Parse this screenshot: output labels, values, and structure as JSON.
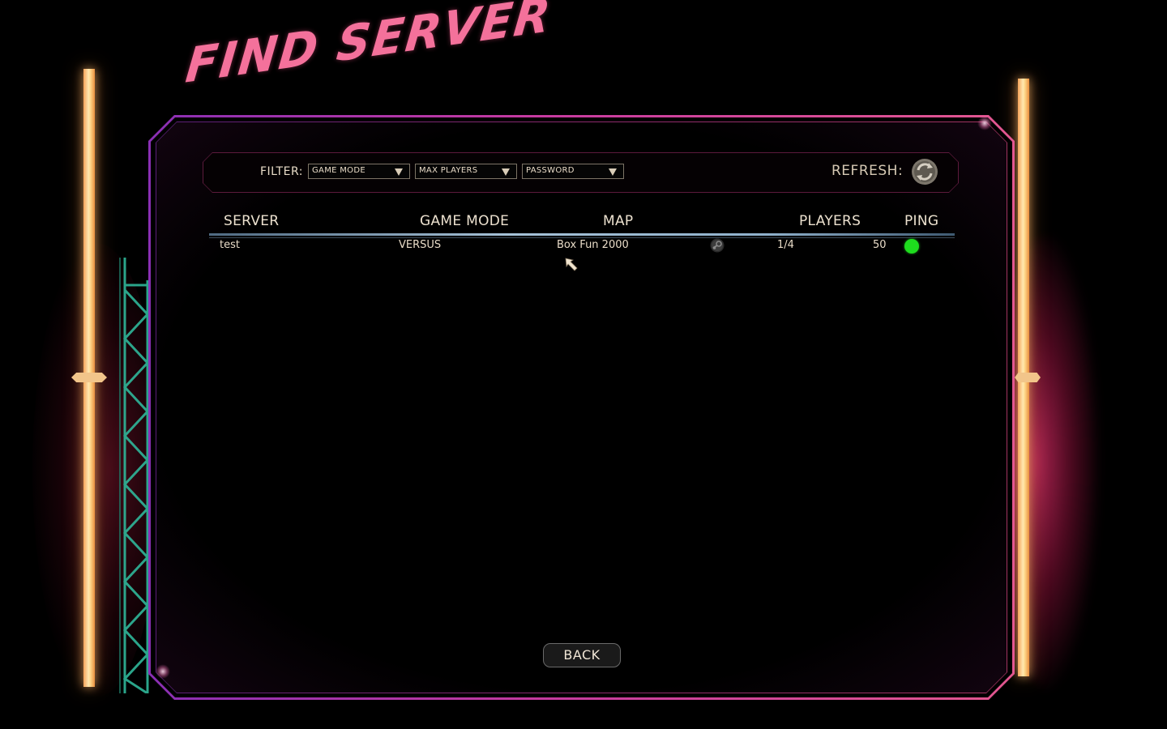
{
  "screen": {
    "title": "FIND SERVER"
  },
  "filters": {
    "label": "FILTER:",
    "game_mode": "GAME MODE",
    "max_players": "MAX PLAYERS",
    "password": "PASSWORD"
  },
  "refresh": {
    "label": "REFRESH:"
  },
  "table": {
    "headers": {
      "server": "SERVER",
      "game_mode": "GAME MODE",
      "map": "MAP",
      "players": "PLAYERS",
      "ping": "PING"
    },
    "rows": [
      {
        "server": "test",
        "game_mode": "VERSUS",
        "map": "Box Fun 2000",
        "players": "1/4",
        "ping": "50",
        "ping_status_color": "#1edc1e",
        "platform_icon": "steam-icon"
      }
    ]
  },
  "footer": {
    "back_label": "BACK"
  },
  "colors": {
    "title_pink": "#f4719b",
    "panel_border": "#c63aa0",
    "text": "#e9dcc8",
    "ping_good": "#1edc1e"
  }
}
